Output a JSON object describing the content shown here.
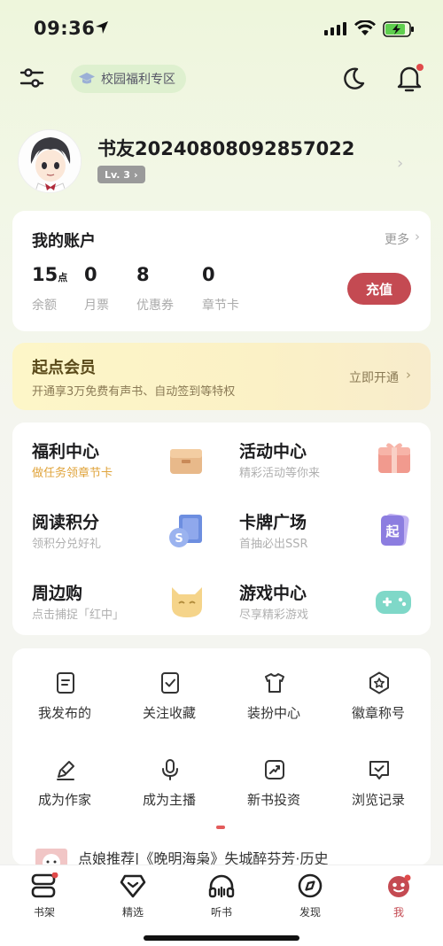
{
  "status": {
    "time": "09:36"
  },
  "header": {
    "campus_label": "校园福利专区"
  },
  "profile": {
    "username": "书友20240808092857022",
    "level": "Lv. 3"
  },
  "account": {
    "title": "我的账户",
    "more": "更多",
    "stats": [
      {
        "value": "15",
        "unit": "点",
        "label": "余额"
      },
      {
        "value": "0",
        "unit": "",
        "label": "月票"
      },
      {
        "value": "8",
        "unit": "",
        "label": "优惠券"
      },
      {
        "value": "0",
        "unit": "",
        "label": "章节卡"
      }
    ],
    "recharge": "充值"
  },
  "vip": {
    "title": "起点会员",
    "subtitle": "开通享3万免费有声书、自动签到等特权",
    "cta": "立即开通"
  },
  "grid": [
    {
      "title": "福利中心",
      "subtitle": "做任务领章节卡",
      "icon": "box-icon"
    },
    {
      "title": "活动中心",
      "subtitle": "精彩活动等你来",
      "icon": "gift-icon"
    },
    {
      "title": "阅读积分",
      "subtitle": "领积分兑好礼",
      "icon": "coin-book-icon"
    },
    {
      "title": "卡牌广场",
      "subtitle": "首抽必出SSR",
      "icon": "card-icon"
    },
    {
      "title": "周边购",
      "subtitle": "点击捕捉「红中」",
      "icon": "cat-icon"
    },
    {
      "title": "游戏中心",
      "subtitle": "尽享精彩游戏",
      "icon": "gamepad-icon"
    }
  ],
  "tools": [
    {
      "label": "我发布的",
      "icon": "document-icon"
    },
    {
      "label": "关注收藏",
      "icon": "bookmark-check-icon"
    },
    {
      "label": "装扮中心",
      "icon": "shirt-icon"
    },
    {
      "label": "徽章称号",
      "icon": "badge-star-icon"
    },
    {
      "label": "成为作家",
      "icon": "pen-icon"
    },
    {
      "label": "成为主播",
      "icon": "microphone-icon"
    },
    {
      "label": "新书投资",
      "icon": "trend-up-icon"
    },
    {
      "label": "浏览记录",
      "icon": "history-icon"
    }
  ],
  "news": {
    "text": "点娘推荐|《晚明海枭》失城醉芬芳·历史"
  },
  "tabs": [
    {
      "label": "书架",
      "icon": "bookshelf-icon"
    },
    {
      "label": "精选",
      "icon": "diamond-icon"
    },
    {
      "label": "听书",
      "icon": "headphones-icon"
    },
    {
      "label": "发现",
      "icon": "compass-icon"
    },
    {
      "label": "我",
      "icon": "profile-icon",
      "active": true
    }
  ],
  "colors": {
    "accent": "#c44a52",
    "vip_bg": "#fdf6c8",
    "sub_orange": "#e0a43c"
  }
}
